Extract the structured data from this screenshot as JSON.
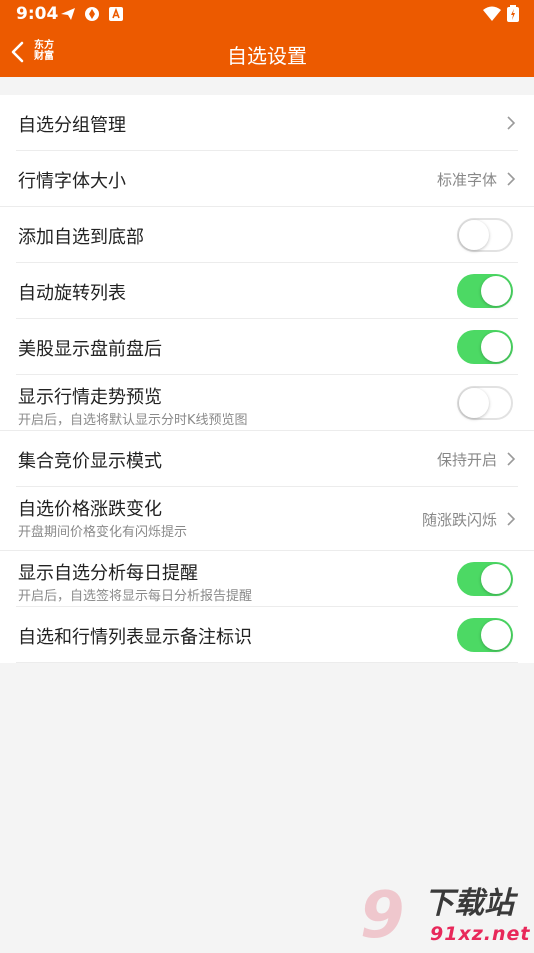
{
  "status_bar": {
    "time": "9:04"
  },
  "nav": {
    "back_label": "back",
    "brand_line1": "东方",
    "brand_line2": "财富",
    "title": "自选设置"
  },
  "colors": {
    "brand": "#ec5a00",
    "toggle_on": "#4cd964"
  },
  "settings": [
    {
      "label": "自选分组管理",
      "value": "",
      "control": "chevron"
    },
    {
      "label": "行情字体大小",
      "value": "标准字体",
      "control": "chevron"
    },
    {
      "label": "添加自选到底部",
      "control": "toggle",
      "on": false
    },
    {
      "label": "自动旋转列表",
      "control": "toggle",
      "on": true
    },
    {
      "label": "美股显示盘前盘后",
      "control": "toggle",
      "on": true
    },
    {
      "label": "显示行情走势预览",
      "sub": "开启后，自选将默认显示分时K线预览图",
      "control": "toggle",
      "on": false
    },
    {
      "label": "集合竞价显示模式",
      "value": "保持开启",
      "control": "chevron"
    },
    {
      "label": "自选价格涨跌变化",
      "sub": "开盘期间价格变化有闪烁提示",
      "value": "随涨跌闪烁",
      "control": "chevron"
    },
    {
      "label": "显示自选分析每日提醒",
      "sub": "开启后，自选签将显示每日分析报告提醒",
      "control": "toggle",
      "on": true
    },
    {
      "label": "自选和行情列表显示备注标识",
      "control": "toggle",
      "on": true
    }
  ],
  "watermark": {
    "logo": "9",
    "text": "下载站",
    "url": "91xz.net"
  }
}
